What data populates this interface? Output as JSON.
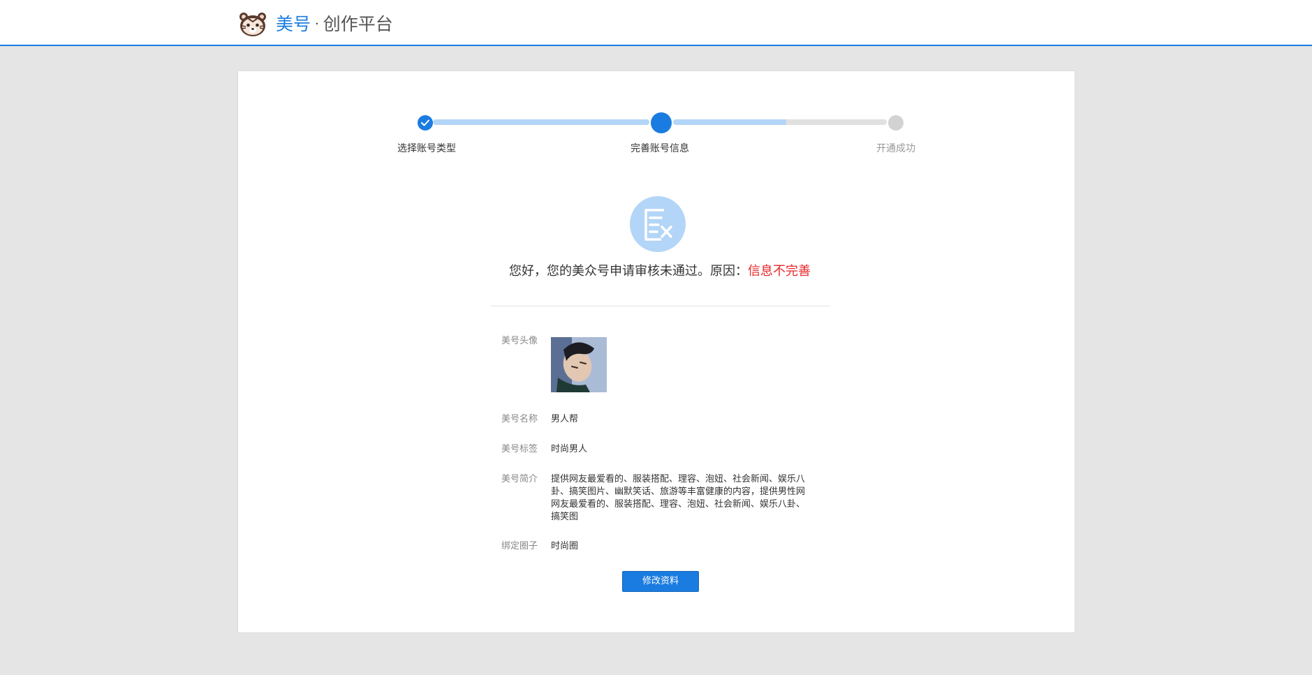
{
  "header": {
    "brand_primary": "美号",
    "brand_separator": "·",
    "brand_secondary": "创作平台",
    "accent_color": "#1a7ce0"
  },
  "steps": [
    {
      "label": "选择账号类型",
      "state": "done"
    },
    {
      "label": "完善账号信息",
      "state": "current"
    },
    {
      "label": "开通成功",
      "state": "pending"
    }
  ],
  "status": {
    "icon": "document-reject-icon",
    "message": "您好，您的美众号申请审核未通过。原因：",
    "reason": "信息不完善",
    "reason_color": "#e8262a"
  },
  "info": {
    "avatar_label": "美号头像",
    "name_label": "美号名称",
    "name_value": "男人帮",
    "tag_label": "美号标签",
    "tag_value": "时尚男人",
    "intro_label": "美号简介",
    "intro_value": "提供网友最爱看的、服装搭配、理容、泡妞、社会新闻、娱乐八卦、搞笑图片、幽默笑话、旅游等丰富健康的内容，提供男性网网友最爱看的、服装搭配、理容、泡妞、社会新闻、娱乐八卦、搞笑图",
    "circle_label": "绑定圈子",
    "circle_value": "时尚圈"
  },
  "actions": {
    "edit_label": "修改资料"
  }
}
